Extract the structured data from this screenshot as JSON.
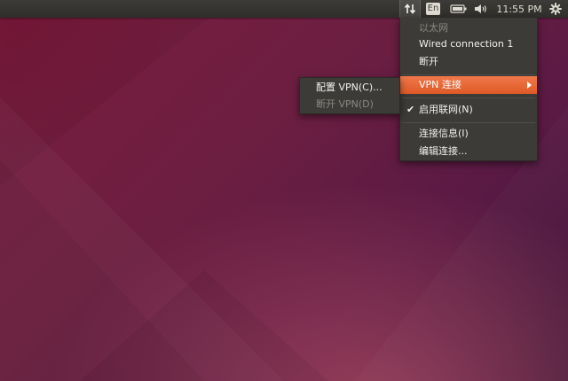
{
  "panel": {
    "keyboard_layout": "En",
    "clock": "11:55 PM",
    "icons": [
      "network-updown-icon",
      "keyboard-layout-icon",
      "battery-icon",
      "volume-icon",
      "gear-icon"
    ]
  },
  "network_menu": {
    "section_header": "以太网",
    "wired_connection": "Wired connection 1",
    "disconnect": "断开",
    "vpn_connections": "VPN 连接",
    "enable_networking": "启用联网(N)",
    "enable_networking_checked": true,
    "connection_info": "连接信息(I)",
    "edit_connections": "编辑连接..."
  },
  "vpn_submenu": {
    "configure_vpn": "配置 VPN(C)...",
    "disconnect_vpn": "断开 VPN(D)"
  },
  "colors": {
    "panel_bg": "#3c3b37",
    "menu_bg": "#3c3b37",
    "highlight": "#e95420",
    "wallpaper": "#6d1f41"
  }
}
